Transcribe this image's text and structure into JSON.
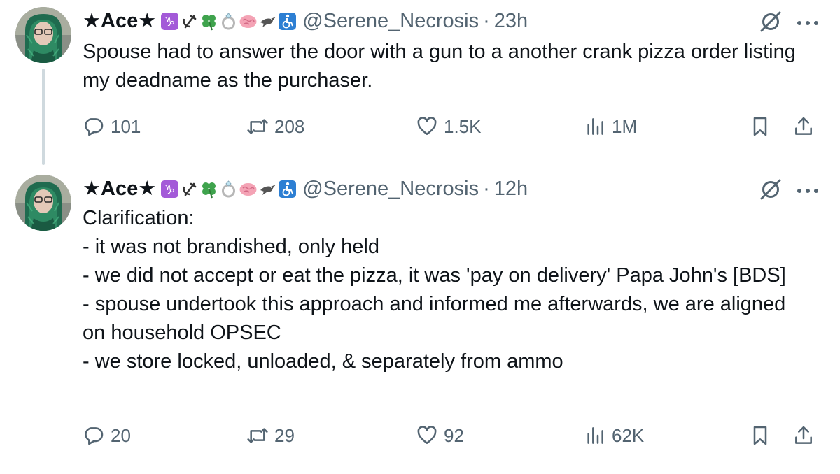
{
  "colors": {
    "text": "#0f1419",
    "secondary": "#536471",
    "thread_line": "#cfd9de"
  },
  "tweets": [
    {
      "author": {
        "name": "★Ace★",
        "emoji_icons": [
          "capricorn-icon",
          "hammer-sickle-icon",
          "four-leaf-clover-icon",
          "ring-icon",
          "brain-icon",
          "bird-icon",
          "wheelchair-icon"
        ],
        "handle": "@Serene_Necrosis"
      },
      "separator": "·",
      "time": "23h",
      "text_lines": [
        "Spouse had to answer the door with a gun to a another crank pizza order listing my deadname as the purchaser."
      ],
      "stats": {
        "replies": "101",
        "retweets": "208",
        "likes": "1.5K",
        "views": "1M"
      }
    },
    {
      "author": {
        "name": "★Ace★",
        "emoji_icons": [
          "capricorn-icon",
          "hammer-sickle-icon",
          "four-leaf-clover-icon",
          "ring-icon",
          "brain-icon",
          "bird-icon",
          "wheelchair-icon"
        ],
        "handle": "@Serene_Necrosis"
      },
      "separator": "·",
      "time": "12h",
      "text_lines": [
        "Clarification:",
        "- it was not brandished, only held",
        "- we did not accept or eat the pizza, it was 'pay on delivery' Papa John's [BDS]",
        "- spouse undertook this approach and informed me afterwards, we are aligned on household OPSEC",
        "- we store locked, unloaded, & separately from ammo"
      ],
      "stats": {
        "replies": "20",
        "retweets": "29",
        "likes": "92",
        "views": "62K"
      }
    }
  ]
}
